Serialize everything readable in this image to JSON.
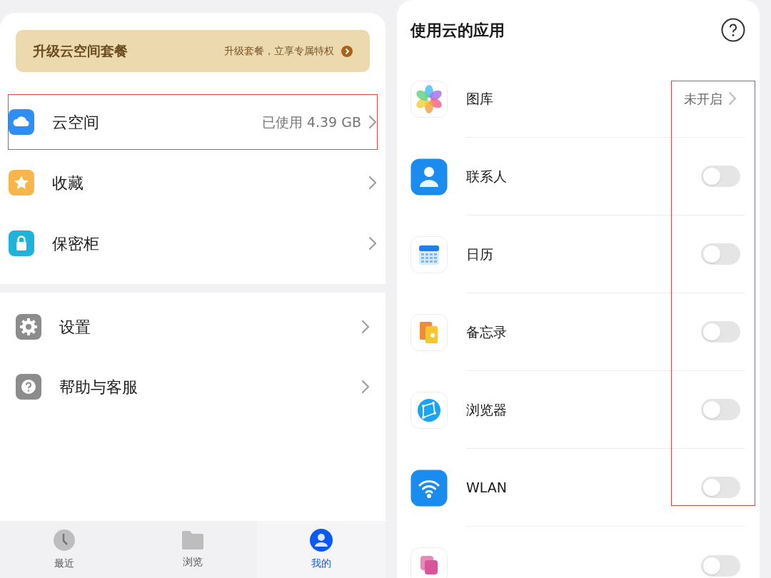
{
  "upgrade_banner": {
    "title": "升级云空间套餐",
    "link": "升级套餐，立享专属特权"
  },
  "menu": [
    {
      "kind": "cloud",
      "label": "云空间",
      "value": "已使用 4.39 GB",
      "highlighted": true
    },
    {
      "kind": "star",
      "label": "收藏",
      "highlighted": false
    },
    {
      "kind": "lock",
      "label": "保密柜",
      "highlighted": false
    }
  ],
  "menu_2": [
    {
      "kind": "gear",
      "label": "设置"
    },
    {
      "kind": "help",
      "label": "帮助与客服"
    }
  ],
  "bottom_nav": [
    {
      "kind": "clock",
      "label": "最近",
      "selected": false
    },
    {
      "kind": "folder",
      "label": "浏览",
      "selected": false
    },
    {
      "kind": "person",
      "label": "我的",
      "selected": true
    }
  ],
  "cloud_apps": {
    "title": "使用云的应用",
    "status_highlighted": true,
    "apps": [
      {
        "kind": "gallery",
        "label": "图库",
        "status": "未开启"
      },
      {
        "kind": "contacts",
        "label": "联系人",
        "on": false
      },
      {
        "kind": "calendar",
        "label": "日历",
        "on": false
      },
      {
        "kind": "notes",
        "label": "备忘录",
        "on": false
      },
      {
        "kind": "browser",
        "label": "浏览器",
        "on": false
      },
      {
        "kind": "wifi",
        "label": "WLAN",
        "on": false
      },
      {
        "kind": "reader",
        "on": false
      }
    ]
  }
}
